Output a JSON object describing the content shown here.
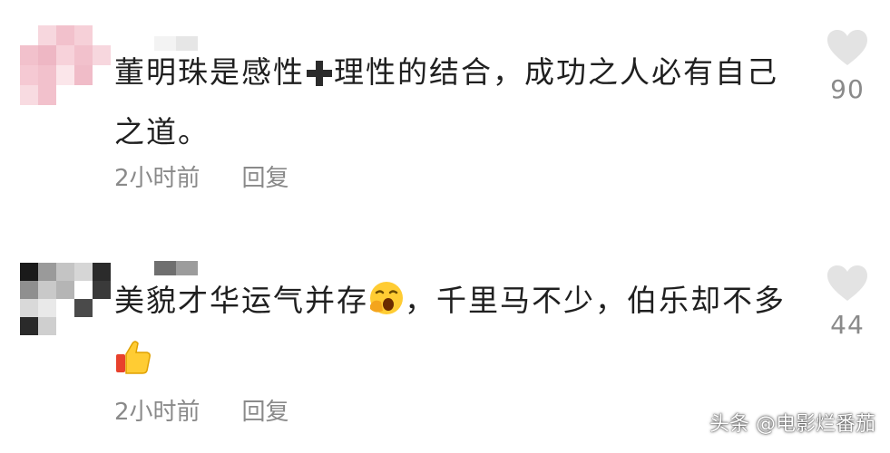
{
  "comments": [
    {
      "text_before": "董明珠是感性",
      "text_after": "理性的结合，成功之人必有自己之道。",
      "time": "2小时前",
      "reply_label": "回复",
      "like_count": "90"
    },
    {
      "text_before": "美貌才华运气并存",
      "text_after": "，千里马不少，伯乐却不多",
      "time": "2小时前",
      "reply_label": "回复",
      "like_count": "44"
    }
  ],
  "icons": {
    "plus": "heavy-plus-icon",
    "emoji_1": "face-with-hand-over-mouth-icon",
    "emoji_2": "thumbs-up-icon",
    "like": "heart-icon"
  },
  "colors": {
    "text": "#1f1f1f",
    "meta": "#8a8a8a",
    "heart": "#e3e3e3",
    "avatar_1": "#f2c1cc",
    "avatar_2": "#7a7a7a"
  },
  "watermark": "头条 @电影烂番茄"
}
